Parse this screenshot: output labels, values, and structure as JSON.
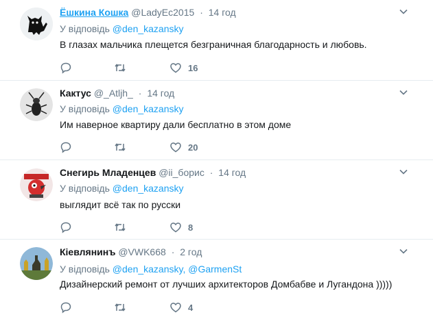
{
  "tweets": [
    {
      "name": "Ёшкина Кошка",
      "handle": "@LadyEc2015",
      "time": "14 год",
      "reply_prefix": "У відповідь",
      "mentions": [
        "@den_kazansky"
      ],
      "text": "В глазах мальчика плещется безграничная благодарность и любовь.",
      "likes": "16",
      "avatar": "black-cat"
    },
    {
      "name": "Кактус",
      "handle": "@_Atljh_",
      "time": "14 год",
      "reply_prefix": "У відповідь",
      "mentions": [
        "@den_kazansky"
      ],
      "text": "Им наверное квартиру дали бесплатно в этом доме",
      "likes": "20",
      "avatar": "beetle"
    },
    {
      "name": "Снегирь Младенцев",
      "handle": "@ii_борис",
      "time": "14 год",
      "reply_prefix": "У відповідь",
      "mentions": [
        "@den_kazansky"
      ],
      "text": "выглядит всё так по русски",
      "likes": "8",
      "avatar": "bird-badge"
    },
    {
      "name": "Кіевлянинъ",
      "handle": "@VWK668",
      "time": "2 год",
      "reply_prefix": "У відповідь",
      "mentions": [
        "@den_kazansky,",
        "@GarmenSt"
      ],
      "text": "Дизайнерский ремонт от лучших архитекторов Домбабве и Лугандона )))))",
      "likes": "4",
      "avatar": "monument"
    }
  ],
  "sep": "·",
  "icons": {
    "reply": "reply-icon",
    "retweet": "retweet-icon",
    "like": "heart-icon",
    "more": "chevron-down-icon"
  },
  "colors": {
    "link": "#1da1f2",
    "muted": "#657786",
    "text": "#14171a",
    "divider": "#e6ecf0"
  }
}
